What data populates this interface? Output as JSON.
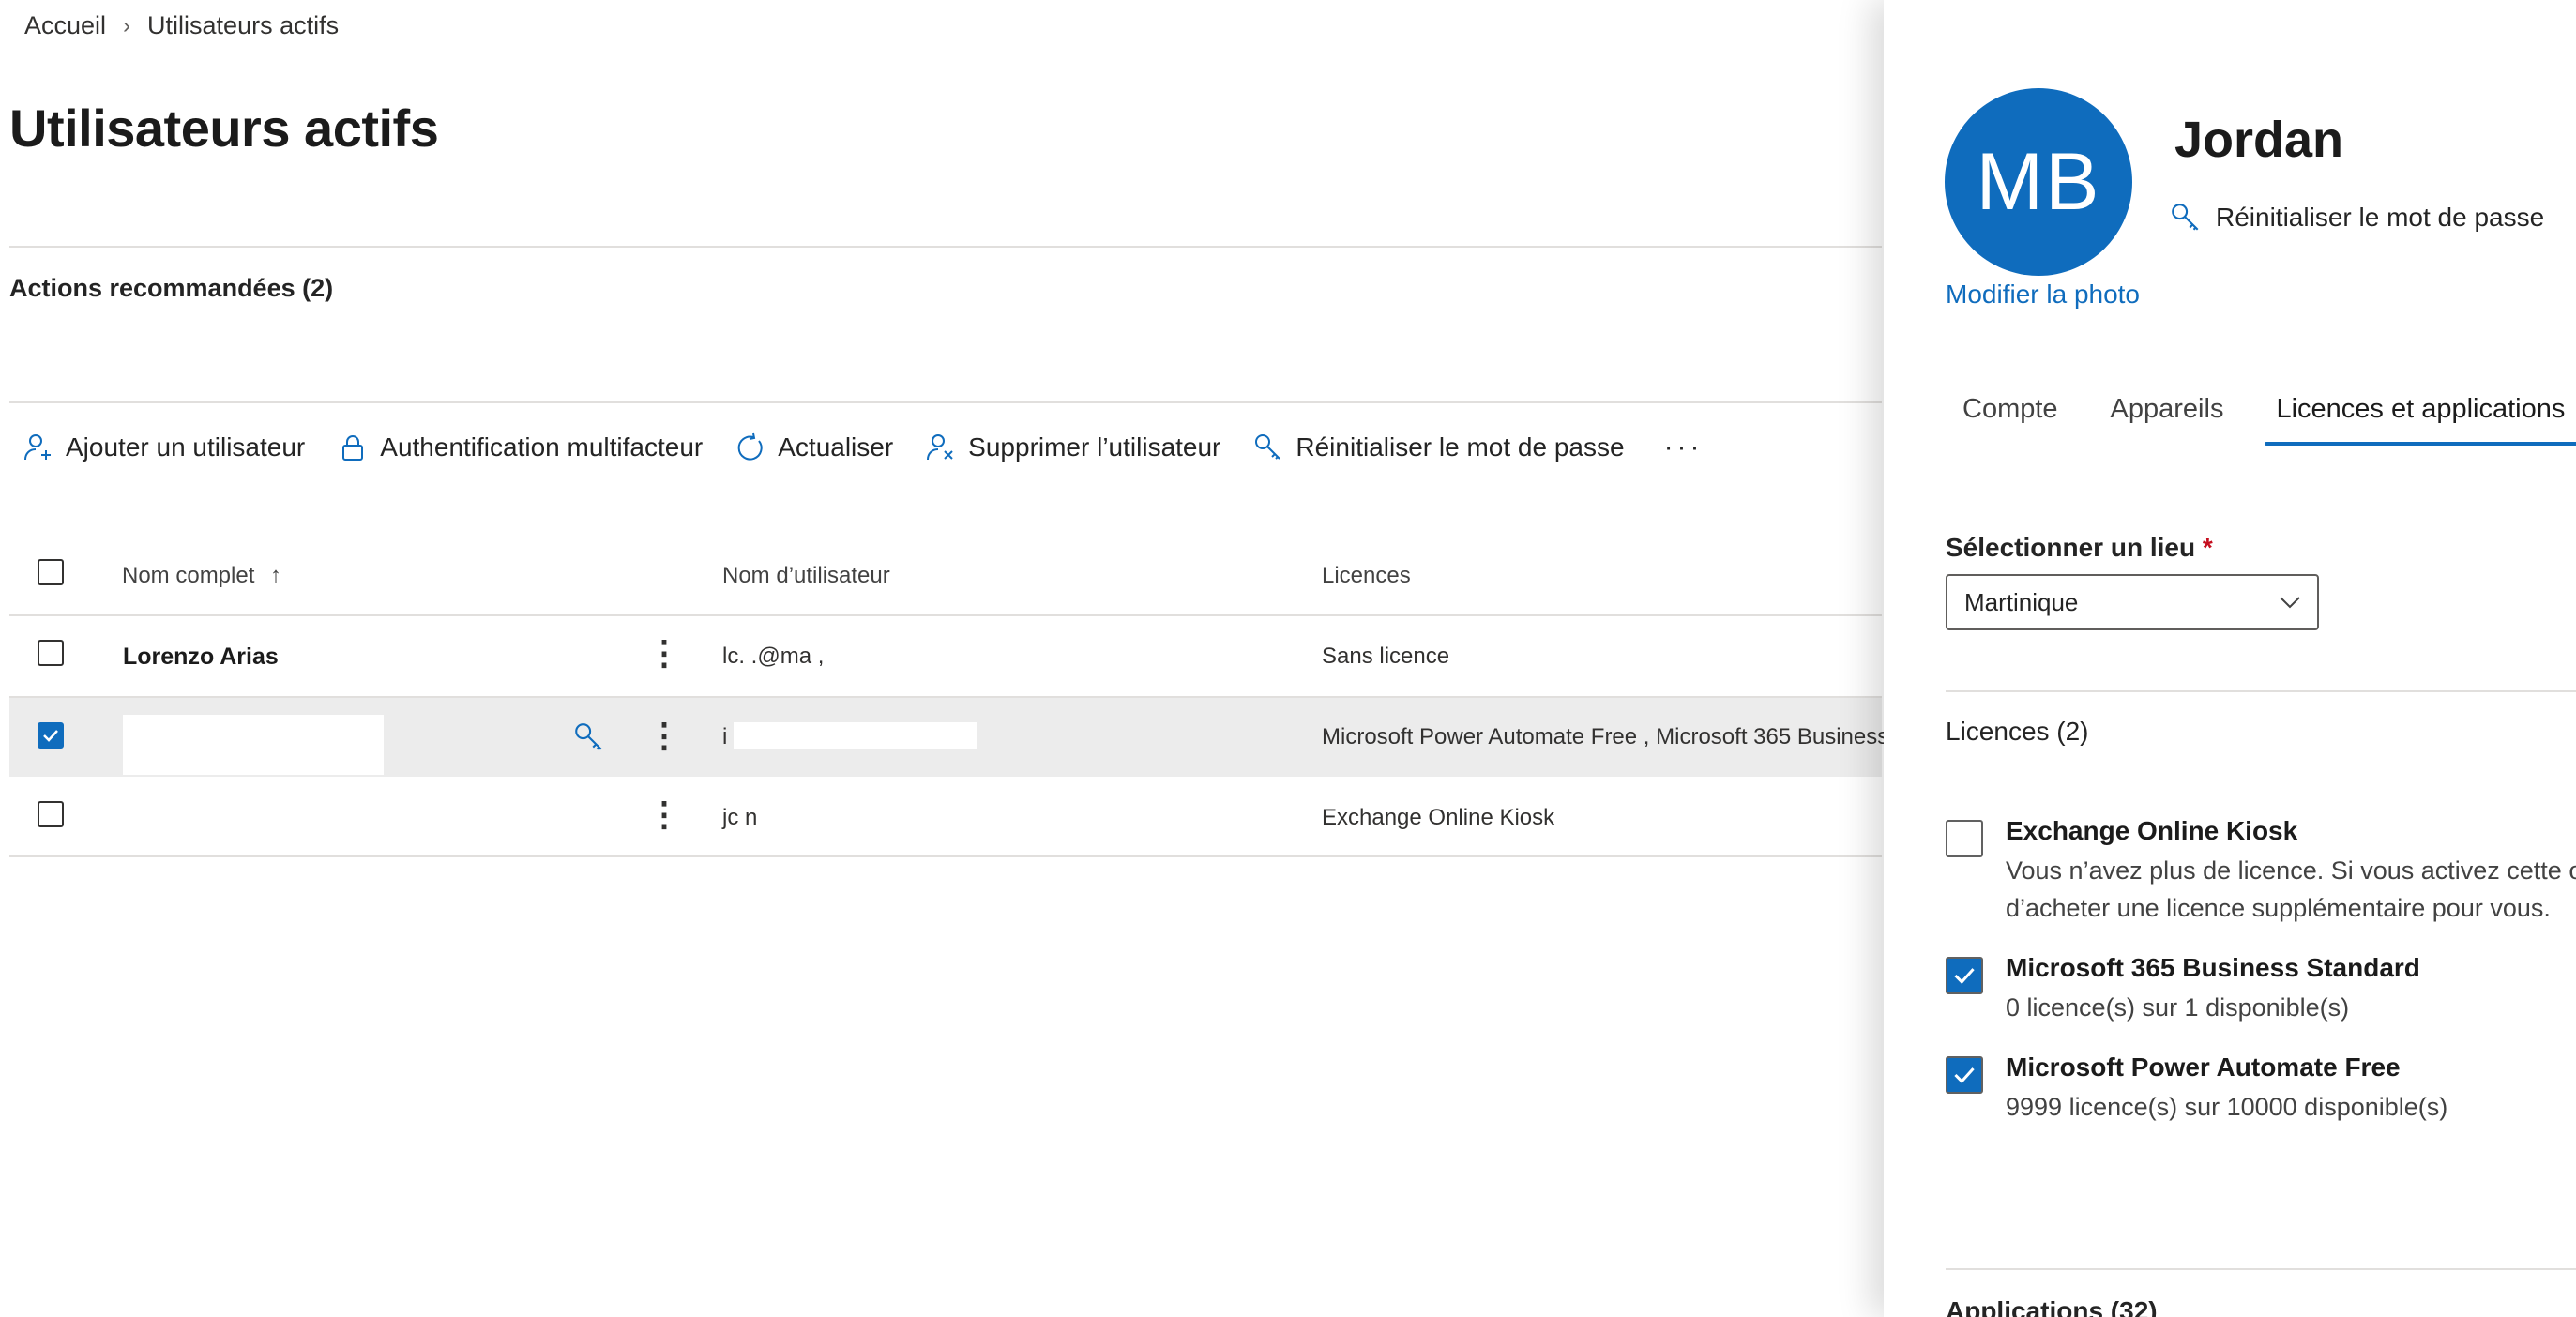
{
  "breadcrumb": {
    "home": "Accueil",
    "current": "Utilisateurs actifs"
  },
  "page": {
    "title": "Utilisateurs actifs",
    "recommended_actions": "Actions recommandées (2)"
  },
  "toolbar": {
    "add_user": "Ajouter un utilisateur",
    "mfa": "Authentification multifacteur",
    "refresh": "Actualiser",
    "delete_user": "Supprimer l’utilisateur",
    "reset_password": "Réinitialiser le mot de passe",
    "more": "···"
  },
  "table": {
    "headers": {
      "full_name": "Nom complet",
      "sort_indicator": "↑",
      "username": "Nom d’utilisateur",
      "licenses": "Licences"
    },
    "rows": [
      {
        "name": "Lorenzo Arias",
        "username": "lc. .@ma          ,",
        "licenses": "Sans licence",
        "selected": false
      },
      {
        "name": "",
        "username": "i",
        "licenses": "Microsoft Power Automate Free , Microsoft 365 Business",
        "selected": true
      },
      {
        "name": "",
        "username": "jc                               n",
        "licenses": "Exchange Online Kiosk",
        "selected": false
      }
    ]
  },
  "panel": {
    "avatar_initials": "MB",
    "user_name": "Jordan",
    "reset_password": "Réinitialiser le mot de passe",
    "change_photo": "Modifier la photo",
    "tabs": [
      "Compte",
      "Appareils",
      "Licences et applications"
    ],
    "active_tab": "Licences et applications",
    "location_label": "Sélectionner un lieu",
    "required_mark": "*",
    "location_value": "Martinique",
    "licenses_title": "Licences (2)",
    "licenses": [
      {
        "name": "Exchange Online Kiosk",
        "desc1": "Vous n’avez plus de licence. Si vous activez cette o",
        "desc2": "d’acheter une licence supplémentaire pour vous.",
        "checked": false
      },
      {
        "name": "Microsoft 365 Business Standard",
        "desc1": "0 licence(s) sur 1 disponible(s)",
        "checked": true
      },
      {
        "name": "Microsoft Power Automate Free",
        "desc1": "9999 licence(s) sur 10000 disponible(s)",
        "checked": true
      }
    ],
    "apps_title": "Applications (32)"
  },
  "colors": {
    "accent": "#0f6cbd",
    "selected_row": "#ececec",
    "required": "#c50f1f"
  }
}
